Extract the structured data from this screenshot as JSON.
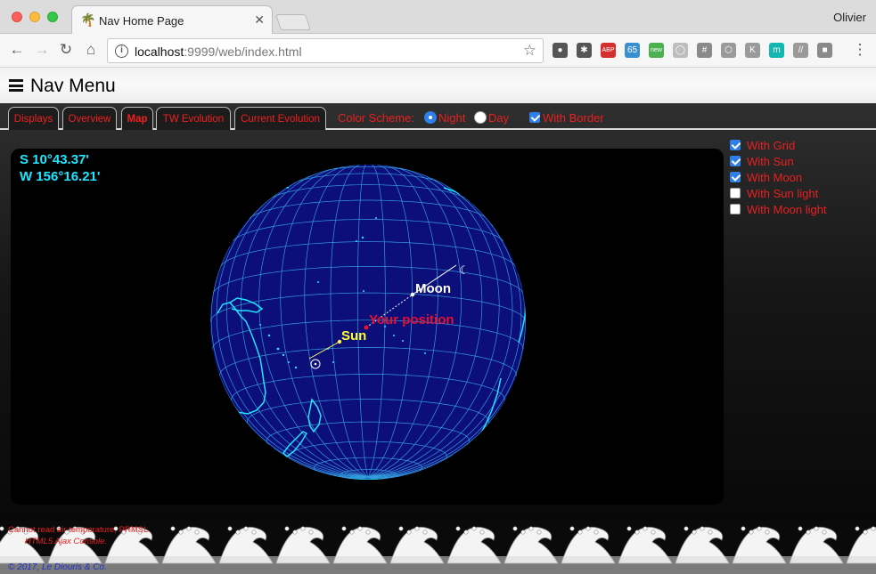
{
  "browser": {
    "tab_title": "Nav Home Page",
    "tab_close": "✕",
    "profile_name": "Olivier",
    "url_host": "localhost",
    "url_path": ":9999/web/index.html",
    "extensions": [
      {
        "name": "evernote-icon",
        "color": "#555555",
        "label": "●"
      },
      {
        "name": "bug-icon",
        "color": "#555555",
        "label": "✱"
      },
      {
        "name": "adblock-icon",
        "color": "#d32f2f",
        "label": "ABP"
      },
      {
        "name": "badge-65-icon",
        "color": "#3a8fd1",
        "label": "65"
      },
      {
        "name": "new-badge-icon",
        "color": "#4caf50",
        "label": "new"
      },
      {
        "name": "circle-ext-icon",
        "color": "#bdbdbd",
        "label": "◯"
      },
      {
        "name": "hash-ext-icon",
        "color": "#8a8a8a",
        "label": "#"
      },
      {
        "name": "hexagon-ext-icon",
        "color": "#9a9a9a",
        "label": "⬡"
      },
      {
        "name": "k-ext-icon",
        "color": "#9a9a9a",
        "label": "K"
      },
      {
        "name": "m-ext-icon",
        "color": "#12b8b0",
        "label": "m"
      },
      {
        "name": "slash-ext-icon",
        "color": "#9a9a9a",
        "label": "//"
      },
      {
        "name": "square-ext-icon",
        "color": "#8a8a8a",
        "label": "■"
      }
    ]
  },
  "header": {
    "title": "Nav Menu"
  },
  "tabs": [
    {
      "label": "Displays",
      "active": false
    },
    {
      "label": "Overview",
      "active": false
    },
    {
      "label": "Map",
      "active": true
    },
    {
      "label": "TW Evolution",
      "active": false
    },
    {
      "label": "Current Evolution",
      "active": false
    }
  ],
  "color_scheme": {
    "label": "Color Scheme:",
    "options": [
      {
        "label": "Night",
        "selected": true
      },
      {
        "label": "Day",
        "selected": false
      }
    ],
    "with_border": {
      "label": "With Border",
      "checked": true
    }
  },
  "map": {
    "latitude": "S 10°43.37'",
    "longitude": "W 156°16.21'",
    "labels": {
      "moon": "Moon",
      "sun": "Sun",
      "position": "Your position"
    },
    "colors": {
      "ocean": "#0c0e7a",
      "grid": "#3cb4ee",
      "coast": "#22e4ff",
      "position": "#e8102e",
      "sun": "#ffff33"
    }
  },
  "options": [
    {
      "label": "With Grid",
      "checked": true
    },
    {
      "label": "With Sun",
      "checked": true
    },
    {
      "label": "With Moon",
      "checked": true
    },
    {
      "label": "With Sun light",
      "checked": false
    },
    {
      "label": "With Moon light",
      "checked": false
    }
  ],
  "footer": {
    "messages": [
      "Cannot read air temperature, PRMSL",
      "HTML5 Ajax Console."
    ],
    "copyright": "© 2017, Le Diouris & Co."
  }
}
